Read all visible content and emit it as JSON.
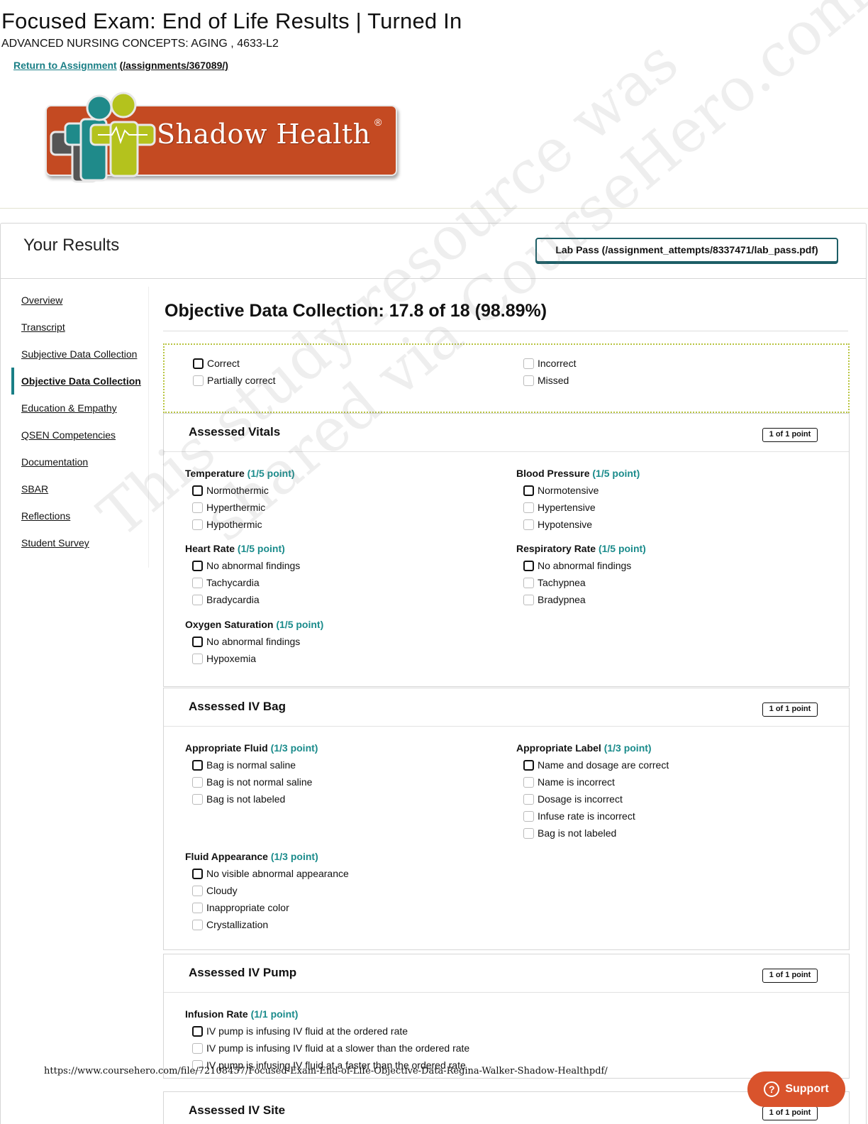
{
  "page": {
    "title": "Focused Exam: End of Life Results | Turned In",
    "course": "ADVANCED NURSING CONCEPTS: AGING , 4633-L2",
    "return_label": "Return to Assignment",
    "return_path": "(/assignments/367089/)"
  },
  "logo": {
    "text": "Shadow Health",
    "reg": "®"
  },
  "results": {
    "heading": "Your Results",
    "lab_pass": "Lab Pass (/assignment_attempts/8337471/lab_pass.pdf)"
  },
  "nav": [
    {
      "label": "Overview",
      "active": false
    },
    {
      "label": "Transcript",
      "active": false
    },
    {
      "label": "Subjective Data Collection",
      "active": false
    },
    {
      "label": "Objective Data Collection",
      "active": true
    },
    {
      "label": "Education & Empathy",
      "active": false
    },
    {
      "label": "QSEN Competencies",
      "active": false
    },
    {
      "label": "Documentation",
      "active": false
    },
    {
      "label": "SBAR",
      "active": false
    },
    {
      "label": "Reflections",
      "active": false
    },
    {
      "label": "Student Survey",
      "active": false
    }
  ],
  "section": {
    "title": "Objective Data Collection: 17.8 of 18 (98.89%)"
  },
  "legend": {
    "correct": "Correct",
    "partial": "Partially correct",
    "incorrect": "Incorrect",
    "missed": "Missed"
  },
  "cards": [
    {
      "title": "Assessed Vitals",
      "badge": "1 of 1 point",
      "groups": [
        {
          "title": "Temperature",
          "points": "(1/5 point)",
          "options": [
            "Normothermic",
            "Hyperthermic",
            "Hypothermic"
          ],
          "selected": 0
        },
        {
          "title": "Blood Pressure",
          "points": "(1/5 point)",
          "options": [
            "Normotensive",
            "Hypertensive",
            "Hypotensive"
          ],
          "selected": 0
        },
        {
          "title": "Heart Rate",
          "points": "(1/5 point)",
          "options": [
            "No abnormal findings",
            "Tachycardia",
            "Bradycardia"
          ],
          "selected": 0
        },
        {
          "title": "Respiratory Rate",
          "points": "(1/5 point)",
          "options": [
            "No abnormal findings",
            "Tachypnea",
            "Bradypnea"
          ],
          "selected": 0
        },
        {
          "title": "Oxygen Saturation",
          "points": "(1/5 point)",
          "options": [
            "No abnormal findings",
            "Hypoxemia"
          ],
          "selected": 0
        }
      ]
    },
    {
      "title": "Assessed IV Bag",
      "badge": "1 of 1 point",
      "groups": [
        {
          "title": "Appropriate Fluid",
          "points": "(1/3 point)",
          "options": [
            "Bag is normal saline",
            "Bag is not normal saline",
            "Bag is not labeled"
          ],
          "selected": 0
        },
        {
          "title": "Appropriate Label",
          "points": "(1/3 point)",
          "options": [
            "Name and dosage are correct",
            "Name is incorrect",
            "Dosage is incorrect",
            "Infuse rate is incorrect",
            "Bag is not labeled"
          ],
          "selected": 0
        },
        {
          "title": "Fluid Appearance",
          "points": "(1/3 point)",
          "options": [
            "No visible abnormal appearance",
            "Cloudy",
            "Inappropriate color",
            "Crystallization"
          ],
          "selected": 0
        }
      ]
    },
    {
      "title": "Assessed IV Pump",
      "badge": "1 of 1 point",
      "groups": [
        {
          "title": "Infusion Rate",
          "points": "(1/1 point)",
          "options": [
            "IV pump is infusing IV fluid at the ordered rate",
            "IV pump is infusing IV fluid at a slower than the ordered rate",
            "IV pump is infusing IV fluid at a faster than the ordered rate"
          ],
          "selected": 0
        }
      ]
    },
    {
      "title": "Assessed IV Site",
      "badge": "1 of 1 point",
      "groups": []
    }
  ],
  "footer": {
    "url": "https://www.coursehero.com/file/72108457/Focused-Exam-End-of-Life-Objective-Data-Regina-Walker-Shadow-Healthpdf/",
    "support": "Support",
    "watermark_line1": "This study resource was",
    "watermark_line2": "shared via CourseHero.com"
  }
}
